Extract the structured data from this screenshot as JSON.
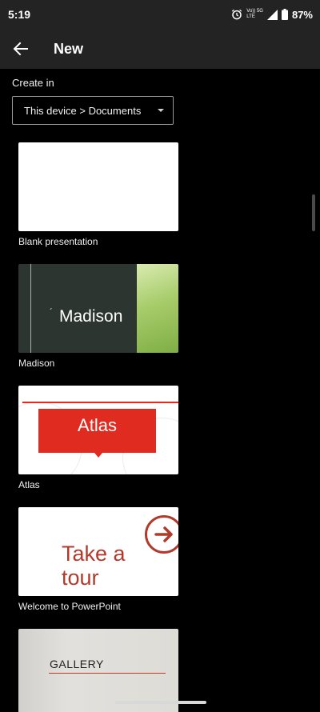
{
  "status_bar": {
    "time": "5:19",
    "network_line1": "Vo)) 5G",
    "network_line2": "LTE",
    "battery": "87%",
    "icons": [
      "alarm-icon",
      "signal-icon",
      "battery-icon"
    ]
  },
  "app_bar": {
    "title": "New",
    "back_icon": "back-arrow-icon"
  },
  "create_in": {
    "label": "Create in",
    "location": "This device > Documents"
  },
  "templates": [
    {
      "caption": "Blank presentation",
      "thumb_text": ""
    },
    {
      "caption": "Madison",
      "thumb_text": "Madison"
    },
    {
      "caption": "Atlas",
      "thumb_text": "Atlas"
    },
    {
      "caption": "Welcome to PowerPoint",
      "thumb_text_line1": "Take a",
      "thumb_text_line2": "tour"
    },
    {
      "caption": "",
      "thumb_text": "GALLERY"
    }
  ],
  "colors": {
    "bar_background": "#232323",
    "background": "#000000",
    "atlas_red": "#e02b20",
    "tour_red": "#b23a2b"
  }
}
